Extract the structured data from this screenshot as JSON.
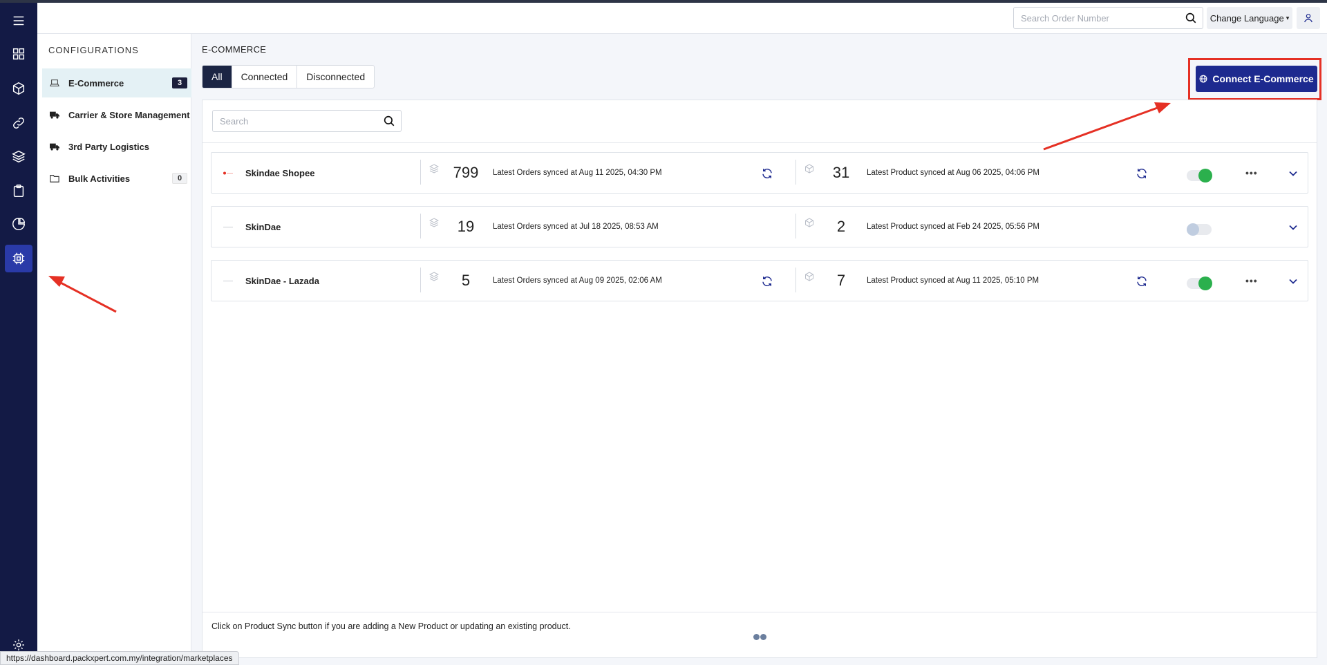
{
  "header": {
    "search_placeholder": "Search Order Number",
    "language_label": "Change Language",
    "language_caret": "▾"
  },
  "rail": {
    "items": [
      "menu-icon",
      "dashboard-icon",
      "box-icon",
      "link-icon",
      "layers-icon",
      "clipboard-icon",
      "pie-chart-icon",
      "chip-icon"
    ],
    "active": "chip-icon",
    "bottom": "settings-icon",
    "accent": "#131a45"
  },
  "config": {
    "title": "CONFIGURATIONS",
    "items": [
      {
        "label": "E-Commerce",
        "badge": "3",
        "icon": "laptop-icon",
        "active": true
      },
      {
        "label": "Carrier & Store Management",
        "badge": "",
        "icon": "truck-icon"
      },
      {
        "label": "3rd Party Logistics",
        "badge": "",
        "icon": "truck-icon"
      },
      {
        "label": "Bulk Activities",
        "badge": "0",
        "icon": "folder-icon"
      }
    ]
  },
  "main": {
    "title": "E-COMMERCE",
    "tabs": [
      "All",
      "Connected",
      "Disconnected"
    ],
    "active_tab": "All",
    "connect_label": "Connect E-Commerce",
    "search_placeholder": "Search",
    "accent": "#1d2a8f"
  },
  "stores": [
    {
      "name": "Skindae Shopee",
      "orders_count": "799",
      "orders_sync": "Latest Orders synced at Aug 11 2025, 04:30 PM",
      "products_count": "31",
      "products_sync": "Latest Product synced at Aug 06 2025, 04:06 PM",
      "enabled": true,
      "show_actions": true
    },
    {
      "name": "SkinDae",
      "orders_count": "19",
      "orders_sync": "Latest Orders synced at Jul 18 2025, 08:53 AM",
      "products_count": "2",
      "products_sync": "Latest Product synced at Feb 24 2025, 05:56 PM",
      "enabled": false,
      "show_actions": false
    },
    {
      "name": "SkinDae - Lazada",
      "orders_count": "5",
      "orders_sync": "Latest Orders synced at Aug 09 2025, 02:06 AM",
      "products_count": "7",
      "products_sync": "Latest Product synced at Aug 11 2025, 05:10 PM",
      "enabled": true,
      "show_actions": true
    }
  ],
  "footer": {
    "note": "Click on Product Sync button if you are adding a New Product or updating an existing product."
  },
  "status_url": "https://dashboard.packxpert.com.my/integration/marketplaces",
  "annotation_color": "#e53024"
}
